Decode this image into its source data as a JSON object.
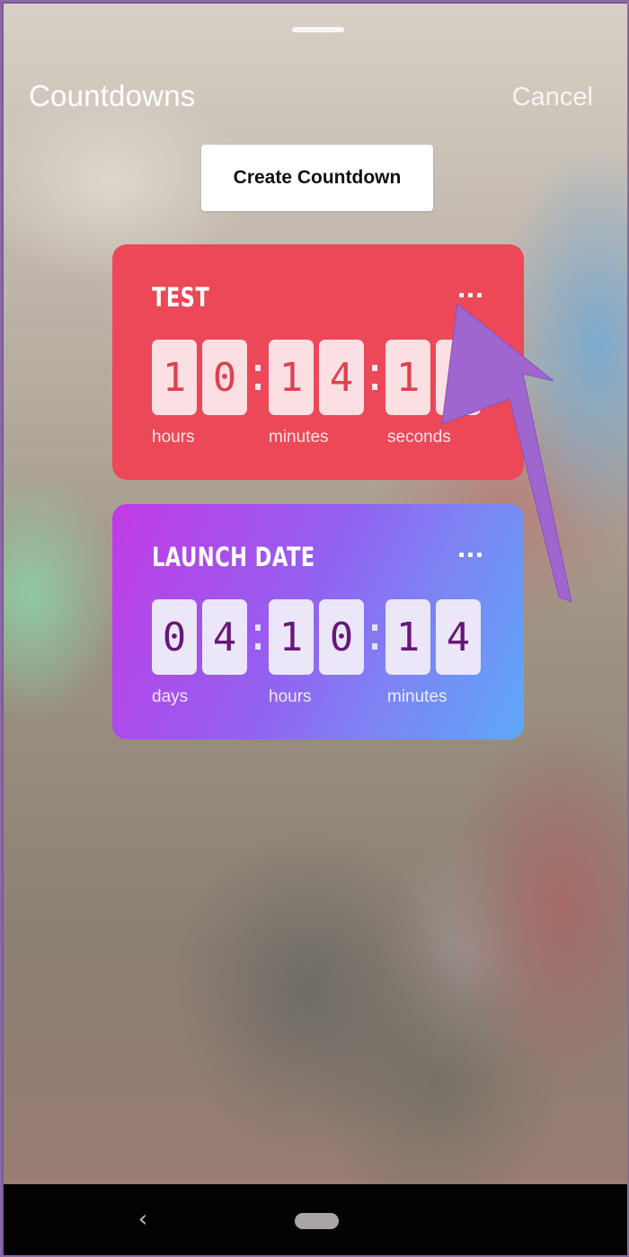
{
  "header": {
    "title": "Countdowns",
    "cancel_label": "Cancel",
    "create_button_label": "Create Countdown"
  },
  "countdowns": [
    {
      "name": "TEST",
      "color": "#ec4858",
      "digits": [
        "1",
        "0",
        "1",
        "4",
        "1",
        ""
      ],
      "units": [
        "hours",
        "minutes",
        "seconds"
      ],
      "more_icon": "more-horizontal-icon"
    },
    {
      "name": "LAUNCH DATE",
      "color_gradient": [
        "#c23ae6",
        "#5ea8fb"
      ],
      "digits": [
        "0",
        "4",
        "1",
        "0",
        "1",
        "4"
      ],
      "units": [
        "days",
        "hours",
        "minutes"
      ],
      "more_icon": "more-horizontal-icon"
    }
  ],
  "annotation": {
    "type": "arrow",
    "color": "#a066d0",
    "points_to": "TEST more options button"
  },
  "navbar": {
    "back_icon": "‹",
    "home_icon": "home-pill-icon"
  }
}
